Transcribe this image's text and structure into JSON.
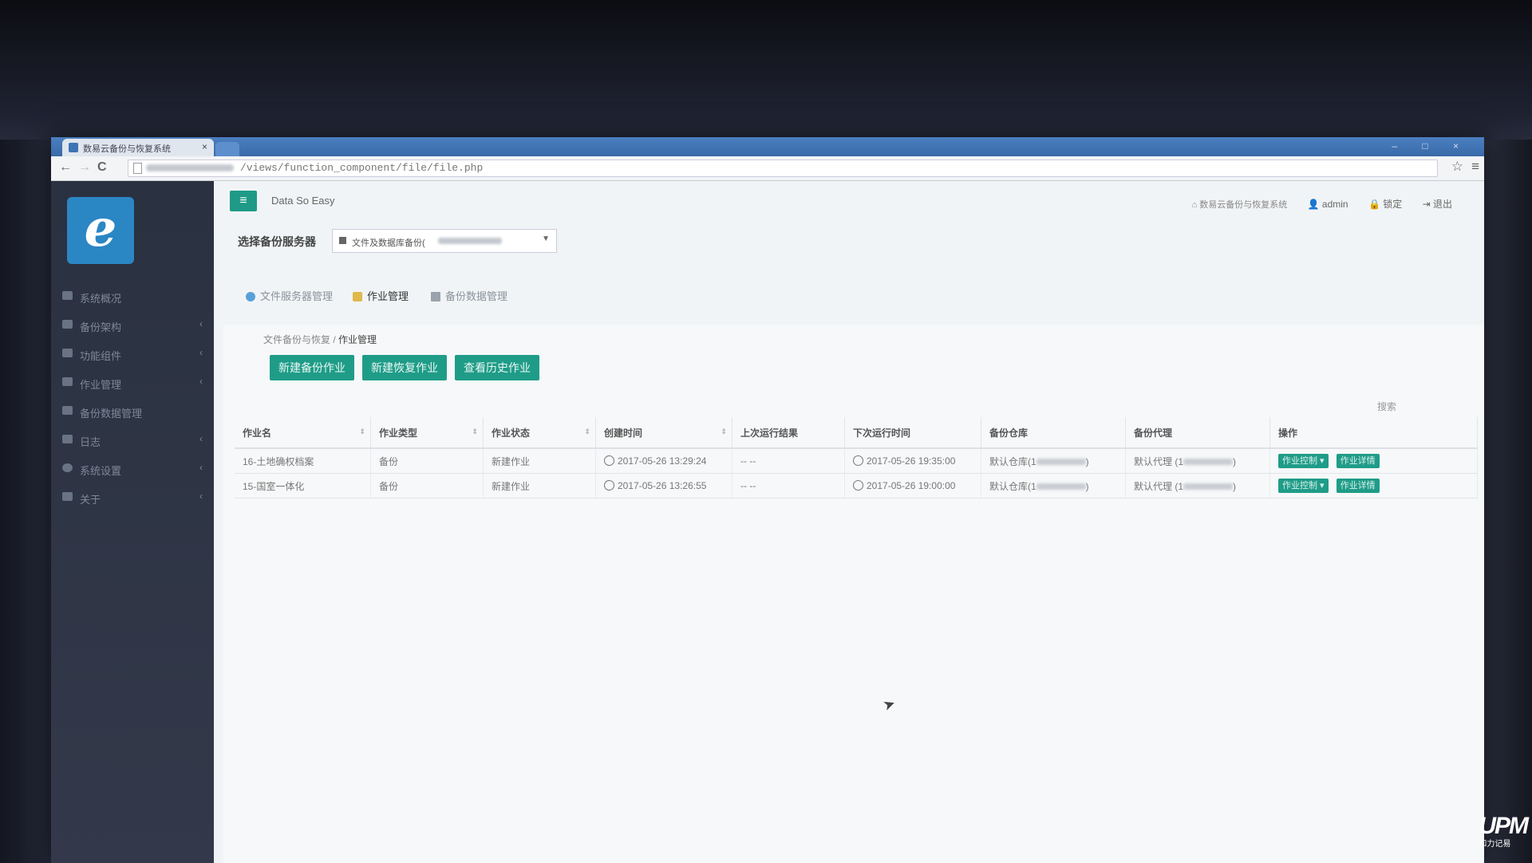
{
  "browser": {
    "tab_title": "数易云备份与恢复系统",
    "tab_close": "×",
    "url_path": "/views/function_component/file/file.php",
    "back_glyph": "←",
    "forward_glyph": "→",
    "reload_glyph": "C",
    "star_glyph": "☆",
    "menu_glyph": "≡",
    "window_controls": "– □ ×"
  },
  "sidebar": {
    "logo_letter": "e",
    "items": [
      {
        "label": "系统概况",
        "chevron": ""
      },
      {
        "label": "备份架构",
        "chevron": "‹"
      },
      {
        "label": "功能组件",
        "chevron": "‹"
      },
      {
        "label": "作业管理",
        "chevron": "‹"
      },
      {
        "label": "备份数据管理",
        "chevron": ""
      },
      {
        "label": "日志",
        "chevron": "‹"
      },
      {
        "label": "系统设置",
        "chevron": "‹"
      },
      {
        "label": "关于",
        "chevron": "‹"
      }
    ]
  },
  "header": {
    "menu_glyph": "≡",
    "brand": "Data So Easy",
    "system_name": "数易云备份与恢复系统",
    "user": "admin",
    "lock": "锁定",
    "logout": "退出"
  },
  "server": {
    "label": "选择备份服务器",
    "selected": "文件及数据库备份(",
    "arrow": "▼"
  },
  "tabs": [
    {
      "label": "文件服务器管理",
      "color": "#5aa0d8"
    },
    {
      "label": "作业管理",
      "color": "#e0b84c"
    },
    {
      "label": "备份数据管理",
      "color": "#9aa2ac"
    }
  ],
  "breadcrumb": {
    "parent": "文件备份与恢复 /",
    "current": "作业管理"
  },
  "actions": {
    "new_backup": "新建备份作业",
    "new_restore": "新建恢复作业",
    "history": "查看历史作业"
  },
  "search_label": "搜索",
  "table": {
    "headers": [
      "作业名",
      "作业类型",
      "作业状态",
      "创建时间",
      "上次运行结果",
      "下次运行时间",
      "备份仓库",
      "备份代理",
      "操作"
    ],
    "sort_glyph": "⇕",
    "rows": [
      {
        "name": "16-土地确权档案",
        "type": "备份",
        "status": "新建作业",
        "created": "2017-05-26 13:29:24",
        "last_result": "-- --",
        "next_run": "2017-05-26 19:35:00",
        "repo": "默认仓库(1",
        "repo_end": ")",
        "agent": "默认代理 (1",
        "agent_end": ")",
        "control": "作业控制 ▾",
        "detail": "作业详情"
      },
      {
        "name": "15-国室一体化",
        "type": "备份",
        "status": "新建作业",
        "created": "2017-05-26 13:26:55",
        "last_result": "-- --",
        "next_run": "2017-05-26 19:00:00",
        "repo": "默认仓库(1",
        "repo_end": ")",
        "agent": "默认代理 (1",
        "agent_end": ")",
        "control": "作业控制 ▾",
        "detail": "作业详情"
      }
    ]
  },
  "watermark": {
    "brand": "UPM",
    "sub": "和力记易"
  },
  "colors": {
    "accent": "#1f9c88",
    "sidebar": "#2d3444",
    "content_bg": "#f1f4f6"
  }
}
